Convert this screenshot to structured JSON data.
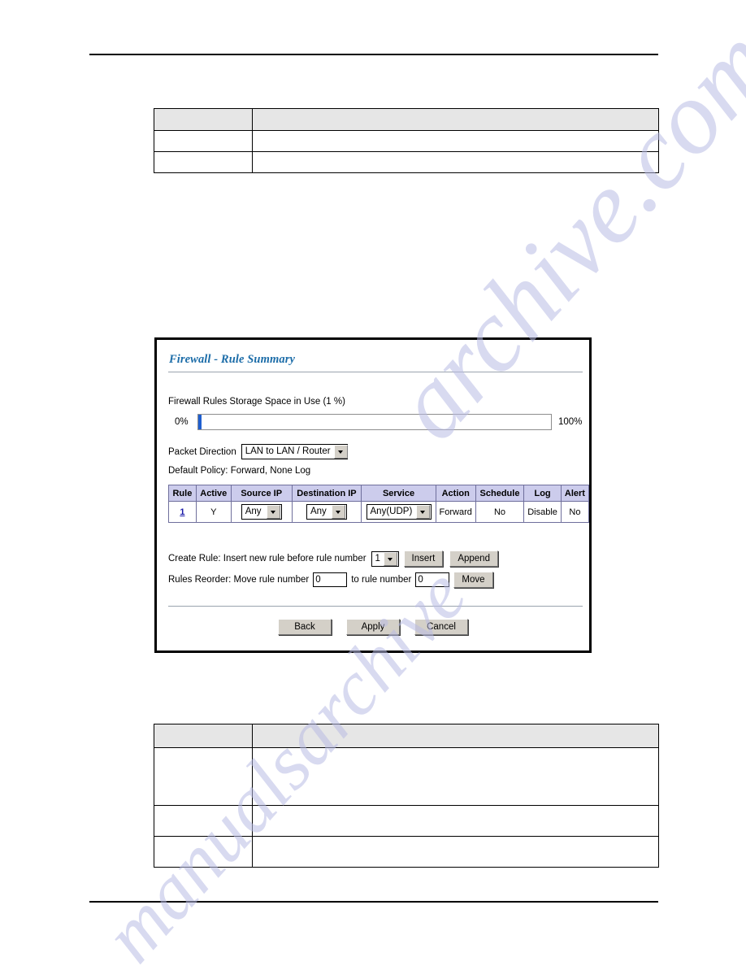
{
  "page": {
    "watermark_text_1": "archive.com",
    "watermark_text_2": "manualsarchive"
  },
  "top_table": {
    "header": [
      "",
      ""
    ],
    "rows": [
      [
        "",
        ""
      ],
      [
        "",
        ""
      ]
    ]
  },
  "bottom_table": {
    "header": [
      "",
      ""
    ],
    "rows": [
      [
        "",
        ""
      ],
      [
        "",
        ""
      ],
      [
        "",
        ""
      ]
    ]
  },
  "screenshot": {
    "title": "Firewall - Rule Summary",
    "storage": {
      "label": "Firewall Rules Storage Space in Use  (1 %)",
      "percent": 1,
      "min_label": "0%",
      "max_label": "100%"
    },
    "packet_direction": {
      "label": "Packet Direction",
      "value": "LAN to LAN / Router"
    },
    "default_policy": "Default Policy: Forward, None Log",
    "rules_table": {
      "columns": [
        "Rule",
        "Active",
        "Source IP",
        "Destination IP",
        "Service",
        "Action",
        "Schedule",
        "Log",
        "Alert"
      ],
      "rows": [
        {
          "rule": "1",
          "active": "Y",
          "source_ip": "Any",
          "destination_ip": "Any",
          "service": "Any(UDP)",
          "action": "Forward",
          "schedule": "No",
          "log": "Disable",
          "alert": "No"
        }
      ]
    },
    "create_rule": {
      "label": "Create Rule: Insert new rule before rule number",
      "number": "1",
      "insert_label": "Insert",
      "append_label": "Append"
    },
    "reorder": {
      "label": "Rules Reorder: Move rule number",
      "from_value": "0",
      "middle_label": "to rule number",
      "to_value": "0",
      "move_label": "Move"
    },
    "buttons": {
      "back": "Back",
      "apply": "Apply",
      "cancel": "Cancel"
    }
  }
}
